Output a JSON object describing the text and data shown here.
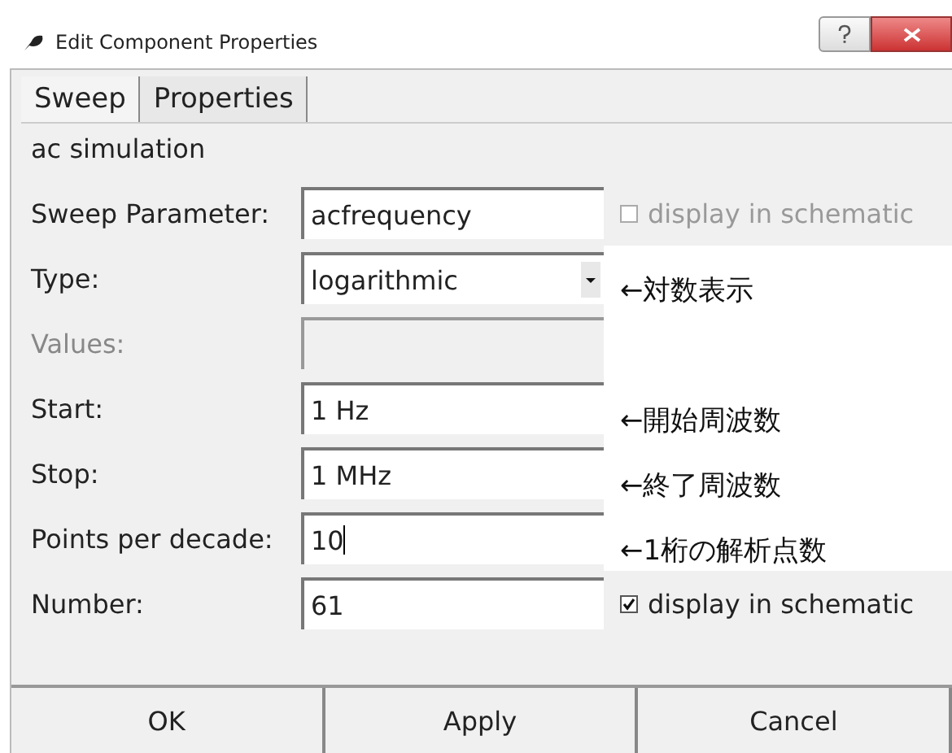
{
  "window": {
    "title": "Edit Component Properties"
  },
  "tabs": [
    {
      "label": "Sweep",
      "selected": true
    },
    {
      "label": "Properties",
      "selected": false
    }
  ],
  "section_title": "ac simulation",
  "rows": [
    {
      "label": "Sweep Parameter:",
      "kind": "text",
      "value": "acfrequency",
      "disabled": false,
      "checkbox": {
        "label": "display in schematic",
        "checked": false,
        "disabled": true
      }
    },
    {
      "label": "Type:",
      "kind": "select",
      "value": "logarithmic",
      "disabled": false,
      "note": "←対数表示"
    },
    {
      "label": "Values:",
      "kind": "text",
      "value": "",
      "disabled": true
    },
    {
      "label": "Start:",
      "kind": "text",
      "value": "1 Hz",
      "disabled": false,
      "note": "←開始周波数"
    },
    {
      "label": "Stop:",
      "kind": "text",
      "value": "1 MHz",
      "disabled": false,
      "note": "←終了周波数"
    },
    {
      "label": "Points per decade:",
      "kind": "text",
      "value": "10",
      "disabled": false,
      "focused": true,
      "note": "←1桁の解析点数"
    },
    {
      "label": "Number:",
      "kind": "text",
      "value": "61",
      "disabled": false,
      "checkbox": {
        "label": "display in schematic",
        "checked": true,
        "disabled": false
      }
    }
  ],
  "buttons": [
    "OK",
    "Apply",
    "Cancel"
  ]
}
